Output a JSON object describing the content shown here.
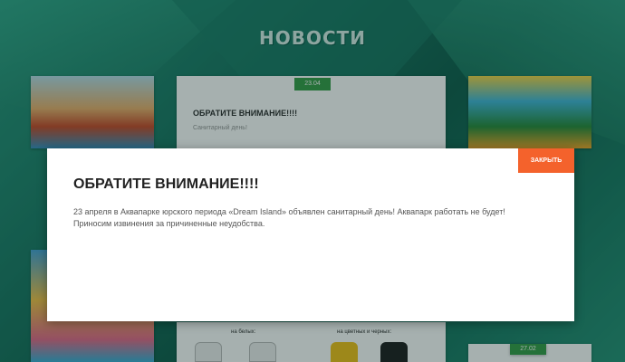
{
  "header": {
    "title": "НОВОСТИ"
  },
  "news_card": {
    "date": "23.04",
    "heading": "ОБРАТИТЕ ВНИМАНИЕ!!!!",
    "subtitle": "Санитарный день!"
  },
  "shirts": {
    "left_label": "на белых:",
    "right_label": "на цветных и черных:"
  },
  "right_card": {
    "date": "27.02"
  },
  "modal": {
    "close_label": "ЗАКРЫТЬ",
    "title": "ОБРАТИТЕ ВНИМАНИЕ!!!!",
    "line1": "23 апреля в  Аквапарке юрского периода «Dream Island»  объявлен санитарный день! Аквапарк работать не будет!",
    "line2": "Приносим извинения за причиненные неудобства."
  },
  "colors": {
    "accent": "#f4622c",
    "date_badge": "#3a9e4a",
    "background": "#1e7a66"
  }
}
